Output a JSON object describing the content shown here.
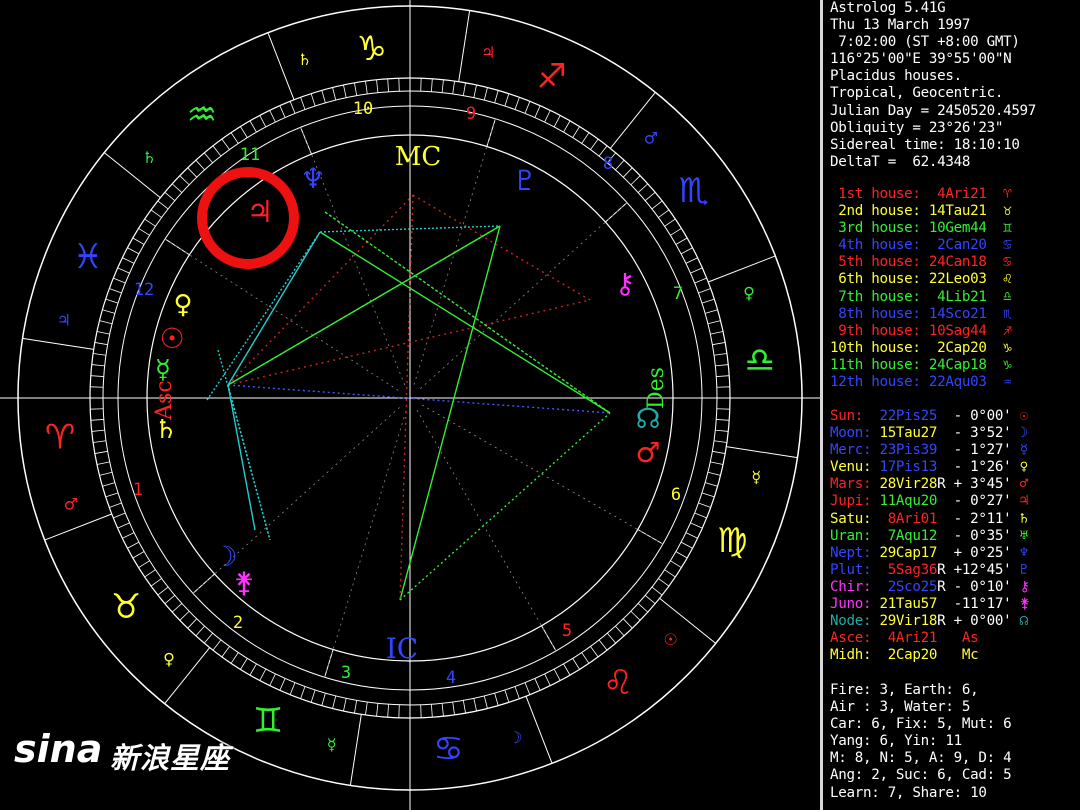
{
  "header": [
    "Astrolog 5.41G",
    "Thu 13 March 1997",
    " 7:02:00 (ST +8:00 GMT)",
    "116°25'00\"E 39°55'00\"N",
    "Placidus houses.",
    "Tropical, Geocentric.",
    "Julian Day = 2450520.4597",
    "Obliquity = 23°26'23\"",
    "Sidereal time: 18:10:10",
    "DeltaT =  62.4348"
  ],
  "houses": [
    {
      "label": "1st house:",
      "value": "4Ari21",
      "glyph": "♈",
      "color": "#ff2222"
    },
    {
      "label": "2nd house:",
      "value": "14Tau21",
      "glyph": "♉",
      "color": "#ffff33"
    },
    {
      "label": "3rd house:",
      "value": "10Gem44",
      "glyph": "♊",
      "color": "#33ee33"
    },
    {
      "label": "4th house:",
      "value": "2Can20",
      "glyph": "♋",
      "color": "#3344ff"
    },
    {
      "label": "5th house:",
      "value": "24Can18",
      "glyph": "♋",
      "color": "#ff2222"
    },
    {
      "label": "6th house:",
      "value": "22Leo03",
      "glyph": "♌",
      "color": "#ffff33"
    },
    {
      "label": "7th house:",
      "value": "4Lib21",
      "glyph": "♎",
      "color": "#33ee33"
    },
    {
      "label": "8th house:",
      "value": "14Sco21",
      "glyph": "♏",
      "color": "#3344ff"
    },
    {
      "label": "9th house:",
      "value": "10Sag44",
      "glyph": "♐",
      "color": "#ff2222"
    },
    {
      "label": "10th house:",
      "value": "2Cap20",
      "glyph": "♑",
      "color": "#ffff33"
    },
    {
      "label": "11th house:",
      "value": "24Cap18",
      "glyph": "♑",
      "color": "#33ee33"
    },
    {
      "label": "12th house:",
      "value": "22Aqu03",
      "glyph": "♒",
      "color": "#3344ff"
    }
  ],
  "planets": [
    {
      "name": "Sun:",
      "pos": "22Pis25",
      "r": " ",
      "decl": "- 0°00'",
      "glyph": "☉",
      "color": "#ff2222",
      "poscolor": "#3344ff"
    },
    {
      "name": "Moon:",
      "pos": "15Tau27",
      "r": " ",
      "decl": "- 3°52'",
      "glyph": "☽",
      "color": "#3344ff",
      "poscolor": "#ffff33"
    },
    {
      "name": "Merc:",
      "pos": "23Pis39",
      "r": " ",
      "decl": "- 1°27'",
      "glyph": "☿",
      "color": "#3344ff",
      "poscolor": "#3344ff"
    },
    {
      "name": "Venu:",
      "pos": "17Pis13",
      "r": " ",
      "decl": "- 1°26'",
      "glyph": "♀",
      "color": "#ffff33",
      "poscolor": "#3344ff"
    },
    {
      "name": "Mars:",
      "pos": "28Vir28",
      "r": "R",
      "decl": "+ 3°45'",
      "glyph": "♂",
      "color": "#ff2222",
      "poscolor": "#ffff33"
    },
    {
      "name": "Jupi:",
      "pos": "11Aqu20",
      "r": " ",
      "decl": "- 0°27'",
      "glyph": "♃",
      "color": "#ff2222",
      "poscolor": "#33ee33"
    },
    {
      "name": "Satu:",
      "pos": "8Ari01",
      "r": " ",
      "decl": "- 2°11'",
      "glyph": "♄",
      "color": "#ffff33",
      "poscolor": "#ff2222"
    },
    {
      "name": "Uran:",
      "pos": "7Aqu12",
      "r": " ",
      "decl": "- 0°35'",
      "glyph": "♅",
      "color": "#33ee33",
      "poscolor": "#33ee33"
    },
    {
      "name": "Nept:",
      "pos": "29Cap17",
      "r": " ",
      "decl": "+ 0°25'",
      "glyph": "♆",
      "color": "#3344ff",
      "poscolor": "#ffff33"
    },
    {
      "name": "Plut:",
      "pos": "5Sag36",
      "r": "R",
      "decl": "+12°45'",
      "glyph": "♇",
      "color": "#3344ff",
      "poscolor": "#ff2222"
    },
    {
      "name": "Chir:",
      "pos": "2Sco25",
      "r": "R",
      "decl": "- 0°10'",
      "glyph": "⚷",
      "color": "#ff33ff",
      "poscolor": "#3344ff"
    },
    {
      "name": "Juno:",
      "pos": "21Tau57",
      "r": " ",
      "decl": "-11°17'",
      "glyph": "⚵",
      "color": "#ff33ff",
      "poscolor": "#ffff33"
    },
    {
      "name": "Node:",
      "pos": "29Vir18",
      "r": "R",
      "decl": "+ 0°00'",
      "glyph": "☊",
      "color": "#22aaaa",
      "poscolor": "#ffff33"
    },
    {
      "name": "Asce:",
      "pos": "4Ari21",
      "r": " ",
      "decl": "",
      "glyph": "As",
      "color": "#ff2222",
      "poscolor": "#ff2222"
    },
    {
      "name": "Midh:",
      "pos": "2Cap20",
      "r": " ",
      "decl": "",
      "glyph": "Mc",
      "color": "#ffff33",
      "poscolor": "#ffff33"
    }
  ],
  "summary": [
    "Fire: 3, Earth: 6,",
    "Air : 3, Water: 5",
    "Car: 6, Fix: 5, Mut: 6",
    "Yang: 6, Yin: 11",
    "M: 8, N: 5, A: 9, D: 4",
    "Ang: 2, Suc: 6, Cad: 5",
    "Learn: 7, Share: 10"
  ],
  "wheel": {
    "house_numbers": [
      "1",
      "2",
      "3",
      "4",
      "5",
      "6",
      "7",
      "8",
      "9",
      "10",
      "11",
      "12"
    ],
    "angle_labels": {
      "asc": "Asc",
      "mc": "MC",
      "des": "Des",
      "ic": "IC"
    },
    "sign_glyphs": [
      "♈",
      "♉",
      "♊",
      "♋",
      "♌",
      "♍",
      "♎",
      "♏",
      "♐",
      "♑",
      "♒",
      "♓"
    ],
    "sign_colors": [
      "#ff2222",
      "#ffff33",
      "#33ee33",
      "#3344ff",
      "#ff2222",
      "#ffff33",
      "#33ee33",
      "#3344ff",
      "#ff2222",
      "#ffff33",
      "#33ee33",
      "#3344ff"
    ],
    "ruler_glyphs": [
      "♂",
      "♀",
      "☿",
      "☽",
      "☉",
      "☿",
      "♀",
      "♂",
      "♃",
      "♄",
      "♄",
      "♃"
    ],
    "highlight": "red-circle-marker"
  },
  "watermark": {
    "logo": "sina",
    "text": "新浪星座"
  },
  "colors": {
    "white": "#ffffff",
    "red": "#ff2222",
    "yellow": "#ffff33",
    "green": "#33ee33",
    "blue": "#3344ff",
    "magenta": "#ff33ff",
    "cyan": "#22aaaa",
    "highlight": "#ee1111"
  }
}
